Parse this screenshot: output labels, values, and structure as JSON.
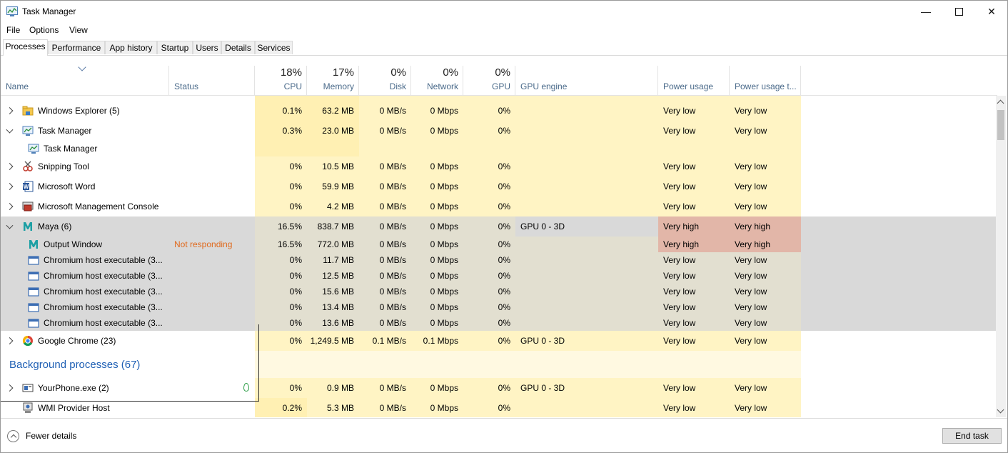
{
  "window": {
    "title": "Task Manager"
  },
  "menu": [
    "File",
    "Options",
    "View"
  ],
  "tabs": [
    "Processes",
    "Performance",
    "App history",
    "Startup",
    "Users",
    "Details",
    "Services"
  ],
  "columns": {
    "name": "Name",
    "status": "Status",
    "cpu": {
      "pct": "18%",
      "label": "CPU"
    },
    "memory": {
      "pct": "17%",
      "label": "Memory"
    },
    "disk": {
      "pct": "0%",
      "label": "Disk"
    },
    "network": {
      "pct": "0%",
      "label": "Network"
    },
    "gpu": {
      "pct": "0%",
      "label": "GPU"
    },
    "gpu_engine": "GPU engine",
    "power": "Power usage",
    "power_trend": "Power usage t..."
  },
  "rows": [
    {
      "name": "Windows Explorer (5)",
      "status": "",
      "cpu": "0.1%",
      "mem": "63.2 MB",
      "disk": "0 MB/s",
      "net": "0 Mbps",
      "gpu": "0%",
      "engine": "",
      "power": "Very low",
      "trend": "Very low"
    },
    {
      "name": "Task Manager",
      "status": "",
      "cpu": "0.3%",
      "mem": "23.0 MB",
      "disk": "0 MB/s",
      "net": "0 Mbps",
      "gpu": "0%",
      "engine": "",
      "power": "Very low",
      "trend": "Very low",
      "child": "Task Manager"
    },
    {
      "name": "Snipping Tool",
      "status": "",
      "cpu": "0%",
      "mem": "10.5 MB",
      "disk": "0 MB/s",
      "net": "0 Mbps",
      "gpu": "0%",
      "engine": "",
      "power": "Very low",
      "trend": "Very low"
    },
    {
      "name": "Microsoft Word",
      "status": "",
      "cpu": "0%",
      "mem": "59.9 MB",
      "disk": "0 MB/s",
      "net": "0 Mbps",
      "gpu": "0%",
      "engine": "",
      "power": "Very low",
      "trend": "Very low"
    },
    {
      "name": "Microsoft Management Console",
      "status": "",
      "cpu": "0%",
      "mem": "4.2 MB",
      "disk": "0 MB/s",
      "net": "0 Mbps",
      "gpu": "0%",
      "engine": "",
      "power": "Very low",
      "trend": "Very low"
    }
  ],
  "maya": {
    "parent": {
      "name": "Maya (6)",
      "cpu": "16.5%",
      "mem": "838.7 MB",
      "disk": "0 MB/s",
      "net": "0 Mbps",
      "gpu": "0%",
      "engine": "GPU 0 - 3D",
      "power": "Very high",
      "trend": "Very high"
    },
    "children": [
      {
        "name": "Output Window",
        "status": "Not responding",
        "cpu": "16.5%",
        "mem": "772.0 MB",
        "disk": "0 MB/s",
        "net": "0 Mbps",
        "gpu": "0%",
        "power": "Very high",
        "trend": "Very high"
      },
      {
        "name": "Chromium host executable (3...",
        "status": "",
        "cpu": "0%",
        "mem": "11.7 MB",
        "disk": "0 MB/s",
        "net": "0 Mbps",
        "gpu": "0%",
        "power": "Very low",
        "trend": "Very low"
      },
      {
        "name": "Chromium host executable (3...",
        "status": "",
        "cpu": "0%",
        "mem": "12.5 MB",
        "disk": "0 MB/s",
        "net": "0 Mbps",
        "gpu": "0%",
        "power": "Very low",
        "trend": "Very low"
      },
      {
        "name": "Chromium host executable (3...",
        "status": "",
        "cpu": "0%",
        "mem": "15.6 MB",
        "disk": "0 MB/s",
        "net": "0 Mbps",
        "gpu": "0%",
        "power": "Very low",
        "trend": "Very low"
      },
      {
        "name": "Chromium host executable (3...",
        "status": "",
        "cpu": "0%",
        "mem": "13.4 MB",
        "disk": "0 MB/s",
        "net": "0 Mbps",
        "gpu": "0%",
        "power": "Very low",
        "trend": "Very low"
      },
      {
        "name": "Chromium host executable (3...",
        "status": "",
        "cpu": "0%",
        "mem": "13.6 MB",
        "disk": "0 MB/s",
        "net": "0 Mbps",
        "gpu": "0%",
        "power": "Very low",
        "trend": "Very low"
      }
    ]
  },
  "chrome": {
    "name": "Google Chrome (23)",
    "cpu": "0%",
    "mem": "1,249.5 MB",
    "disk": "0.1 MB/s",
    "net": "0.1 Mbps",
    "gpu": "0%",
    "engine": "GPU 0 - 3D",
    "power": "Very low",
    "trend": "Very low"
  },
  "background_title": "Background processes (67)",
  "background": [
    {
      "name": "YourPhone.exe (2)",
      "cpu": "0%",
      "mem": "0.9 MB",
      "disk": "0 MB/s",
      "net": "0 Mbps",
      "gpu": "0%",
      "engine": "GPU 0 - 3D",
      "power": "Very low",
      "trend": "Very low"
    },
    {
      "name": "WMI Provider Host",
      "cpu": "0.2%",
      "mem": "5.3 MB",
      "disk": "0 MB/s",
      "net": "0 Mbps",
      "gpu": "0%",
      "engine": "",
      "power": "Very low",
      "trend": "Very low"
    }
  ],
  "footer": {
    "fewer": "Fewer details",
    "end_task": "End task"
  },
  "colors": {
    "light": "#fff4c4",
    "mid": "#fff0b3",
    "cpu_high": "#f9e8a8",
    "high": "#e2b6a8",
    "sel": "#d9d9d9",
    "sel_heat": "#e2dfd0",
    "section": "#fff9e1"
  }
}
